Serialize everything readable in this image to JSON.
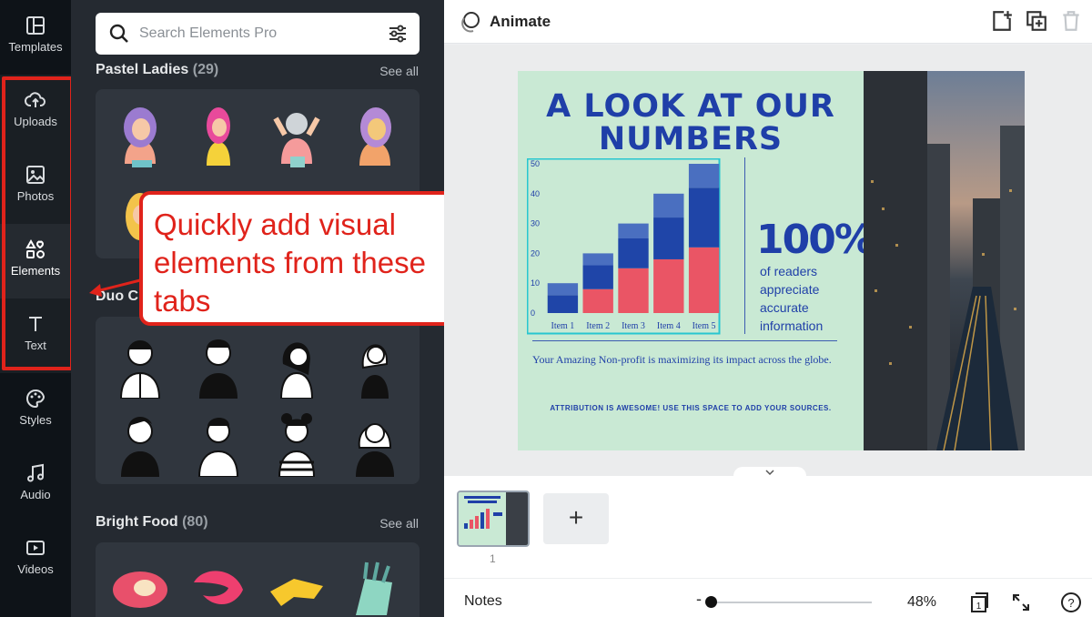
{
  "sidebar": {
    "items": [
      {
        "label": "Templates",
        "icon": "templates-icon"
      },
      {
        "label": "Uploads",
        "icon": "upload-icon"
      },
      {
        "label": "Photos",
        "icon": "photos-icon"
      },
      {
        "label": "Elements",
        "icon": "elements-icon"
      },
      {
        "label": "Text",
        "icon": "text-icon"
      },
      {
        "label": "Styles",
        "icon": "palette-icon"
      },
      {
        "label": "Audio",
        "icon": "music-icon"
      },
      {
        "label": "Videos",
        "icon": "video-icon"
      }
    ],
    "highlight_color": "#e0231b"
  },
  "panel": {
    "search": {
      "placeholder": "Search Elements Pro"
    },
    "sections": [
      {
        "title": "Pastel Ladies",
        "count": "(29)",
        "see_all": "See all"
      },
      {
        "title": "Duo C",
        "count": "",
        "see_all": ""
      },
      {
        "title": "Bright Food",
        "count": "(80)",
        "see_all": "See all"
      }
    ]
  },
  "callout": {
    "text": "Quickly add visual elements from these tabs",
    "color": "#e0231b"
  },
  "topbar": {
    "animate_label": "Animate"
  },
  "design": {
    "title_line1": "A LOOK AT OUR",
    "title_line2": "NUMBERS",
    "stat_value": "100%",
    "stat_text": "of readers appreciate accurate information",
    "tagline": "Your Amazing Non-profit is maximizing its impact across the globe.",
    "attribution": "ATTRIBUTION IS AWESOME! USE THIS SPACE TO ADD YOUR SOURCES.",
    "background": "#c9e9d4",
    "accent": "#1f3fa8"
  },
  "chart_data": {
    "type": "bar",
    "stacked": true,
    "categories": [
      "Item 1",
      "Item 2",
      "Item 3",
      "Item 4",
      "Item 5"
    ],
    "ylim": [
      0,
      50
    ],
    "yticks": [
      0,
      10,
      20,
      30,
      40,
      50
    ],
    "series": [
      {
        "values": [
          0,
          8,
          15,
          18,
          22
        ],
        "color": "#ea5565"
      },
      {
        "values": [
          6,
          8,
          10,
          14,
          20
        ],
        "color": "#1f45a8"
      },
      {
        "values": [
          4,
          4,
          5,
          8,
          8
        ],
        "color": "#4a6fc0"
      }
    ]
  },
  "pages": {
    "page_number": "1",
    "add_label": "+"
  },
  "bottombar": {
    "notes_label": "Notes",
    "zoom_minus": "-",
    "zoom": "48%",
    "page_count": "1",
    "help": "?"
  }
}
